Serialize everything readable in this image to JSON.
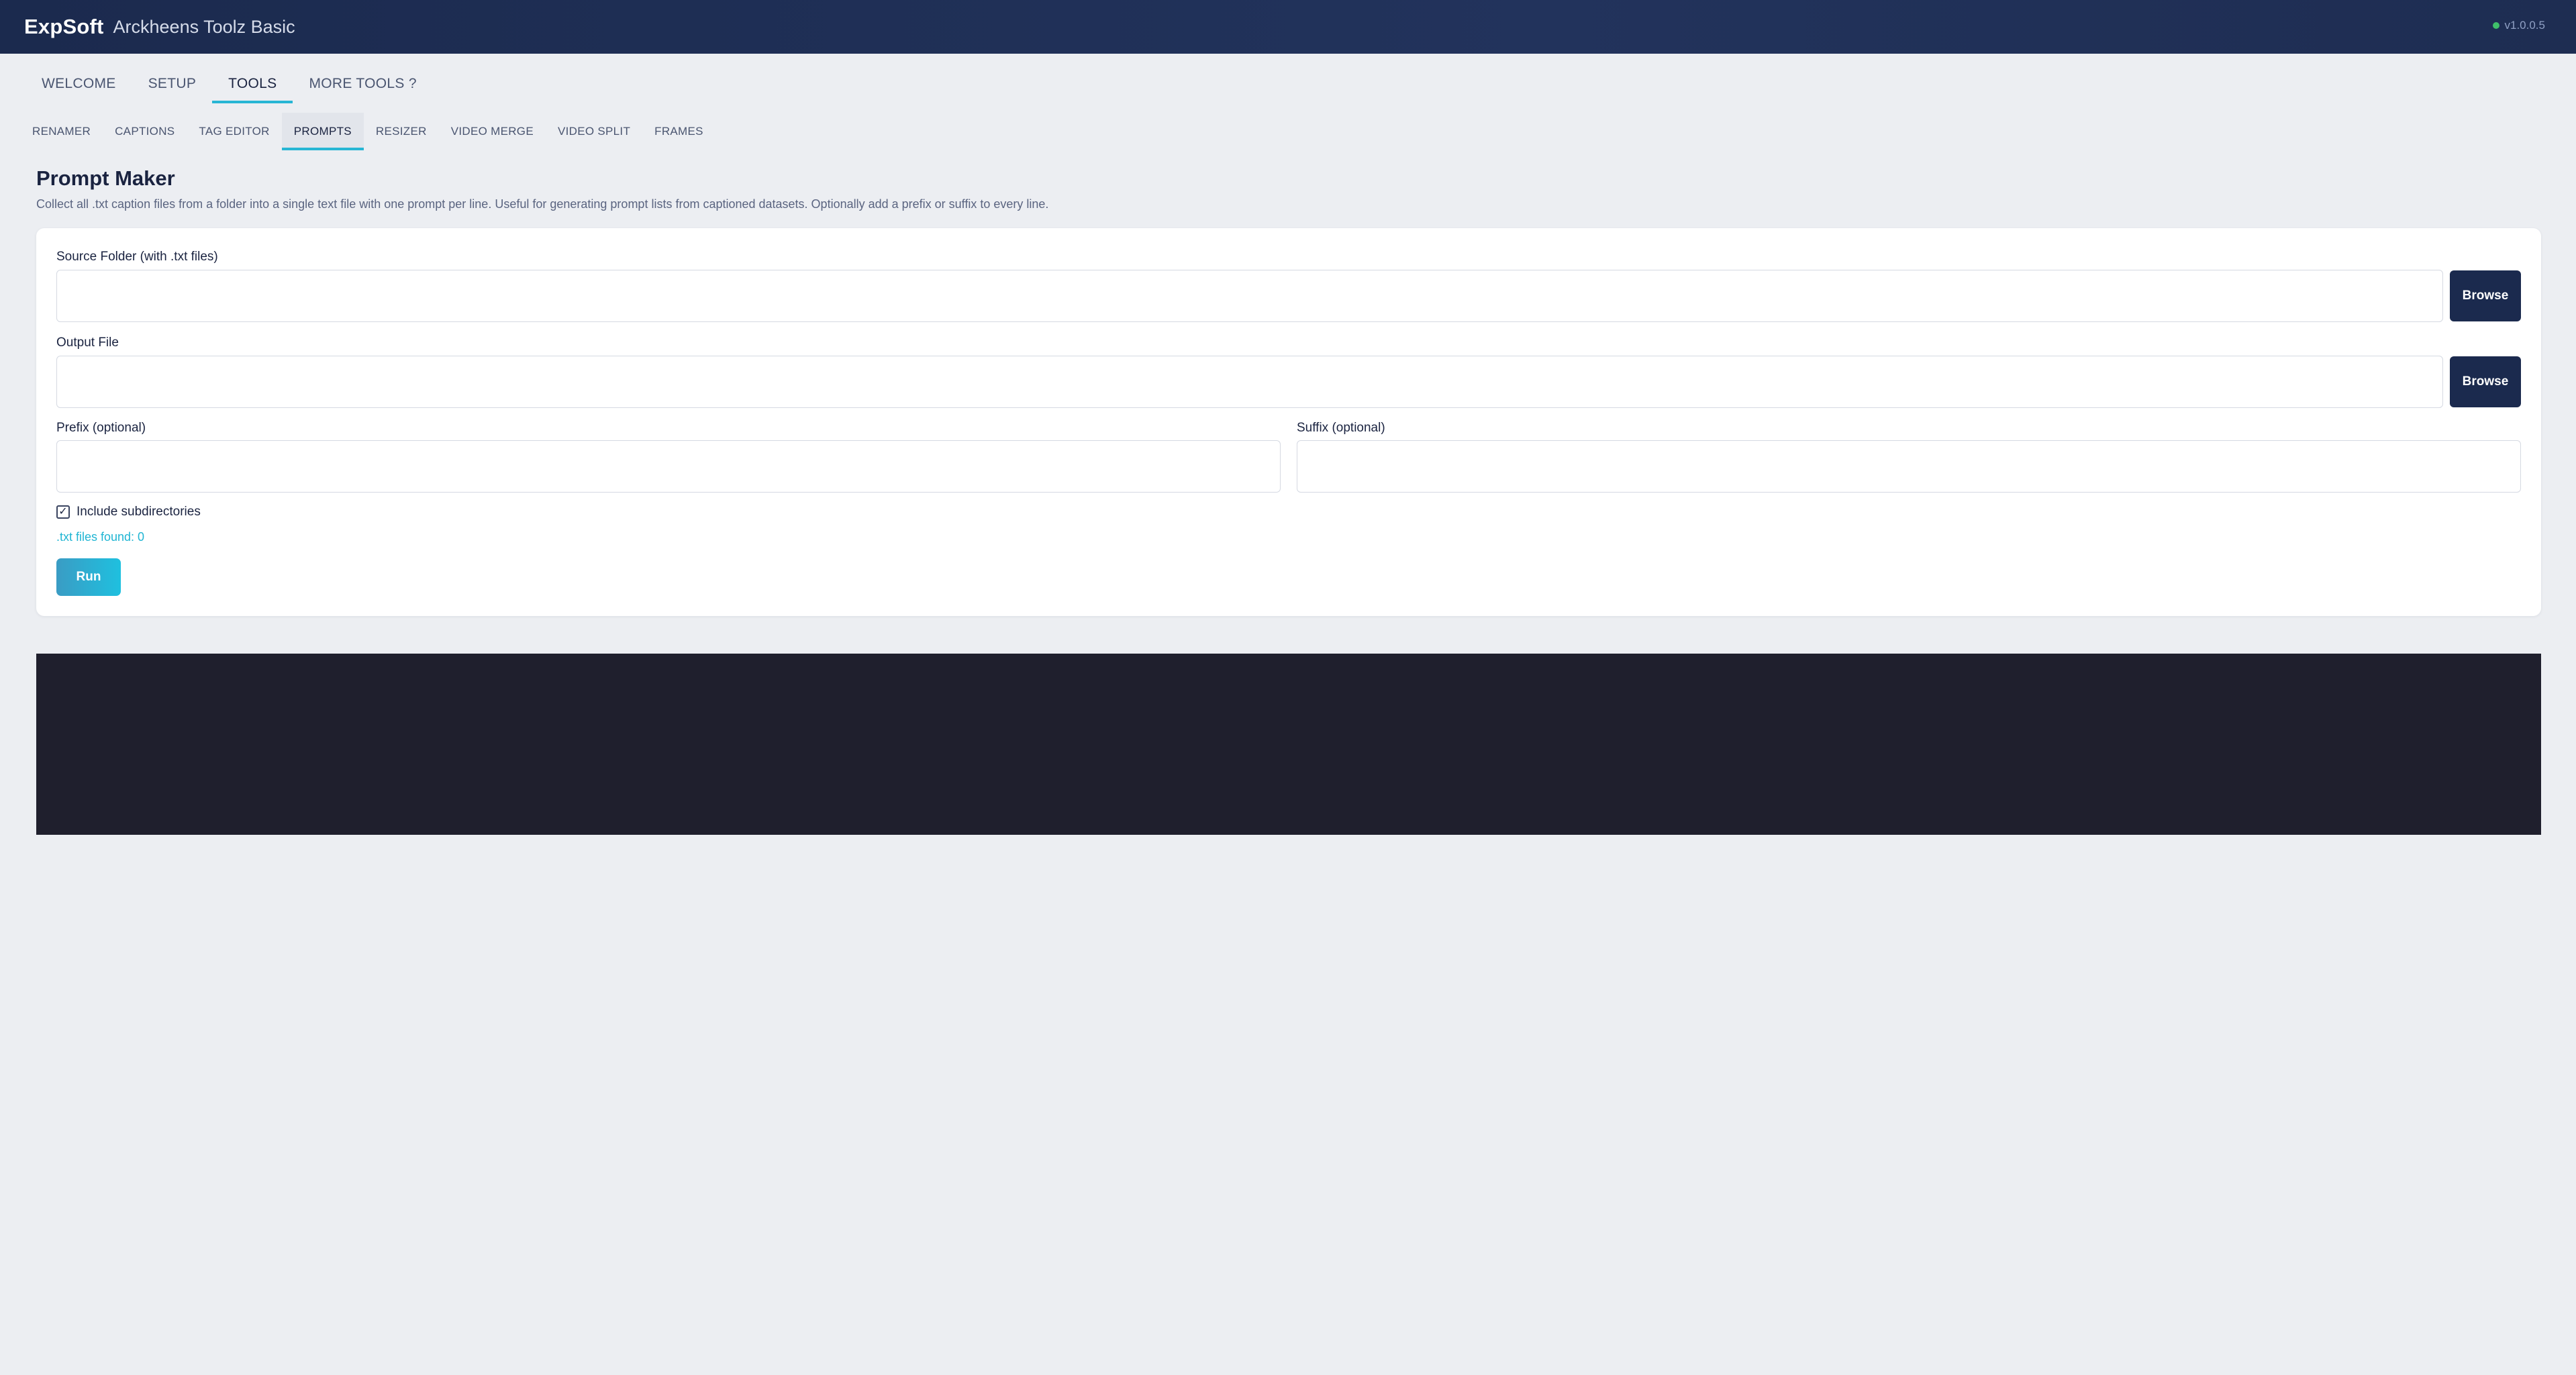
{
  "header": {
    "brand": "ExpSoft",
    "app_name": "Arckheens Toolz Basic",
    "version": "v1.0.0.5",
    "status_color": "#3fbf6a"
  },
  "main_tabs": [
    {
      "label": "WELCOME",
      "active": false
    },
    {
      "label": "SETUP",
      "active": false
    },
    {
      "label": "TOOLS",
      "active": true
    },
    {
      "label": "MORE TOOLS ?",
      "active": false
    }
  ],
  "sub_tabs": [
    {
      "label": "RENAMER",
      "active": false
    },
    {
      "label": "CAPTIONS",
      "active": false
    },
    {
      "label": "TAG EDITOR",
      "active": false
    },
    {
      "label": "PROMPTS",
      "active": true
    },
    {
      "label": "RESIZER",
      "active": false
    },
    {
      "label": "VIDEO MERGE",
      "active": false
    },
    {
      "label": "VIDEO SPLIT",
      "active": false
    },
    {
      "label": "FRAMES",
      "active": false
    }
  ],
  "page": {
    "title": "Prompt Maker",
    "description": "Collect all .txt caption files from a folder into a single text file with one prompt per line. Useful for generating prompt lists from captioned datasets. Optionally add a prefix or suffix to every line."
  },
  "form": {
    "source_label": "Source Folder (with .txt files)",
    "source_value": "",
    "output_label": "Output File",
    "output_value": "",
    "prefix_label": "Prefix (optional)",
    "prefix_value": "",
    "suffix_label": "Suffix (optional)",
    "suffix_value": "",
    "browse_label": "Browse",
    "include_subdirs_label": "Include subdirectories",
    "include_subdirs_checked": true,
    "files_found_text": ".txt files found: 0",
    "run_label": "Run"
  },
  "colors": {
    "accent": "#27b6d4",
    "header_bg": "#1b2a4e",
    "console_bg": "#1f1f2d"
  }
}
